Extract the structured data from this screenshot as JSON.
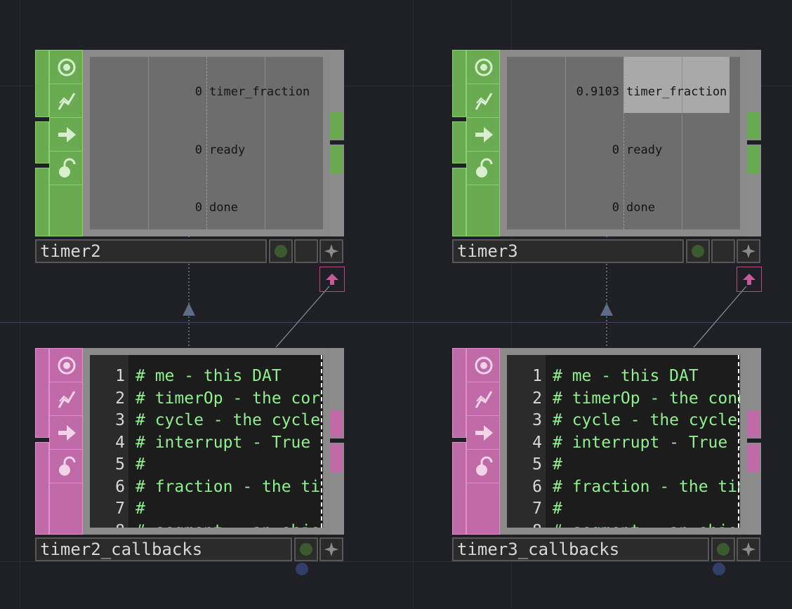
{
  "theme": {
    "chop_accent": "#6aab52",
    "chop_border": "#86d46b",
    "dat_accent": "#c06aa8",
    "dat_border": "#e28ed0"
  },
  "timer2": {
    "name": "timer2",
    "channels": [
      {
        "value": "0",
        "name": "timer_fraction"
      },
      {
        "value": "0",
        "name": "ready"
      },
      {
        "value": "0",
        "name": "done"
      }
    ],
    "fraction": 0
  },
  "timer3": {
    "name": "timer3",
    "channels": [
      {
        "value": "0.9103",
        "name": "timer_fraction"
      },
      {
        "value": "0",
        "name": "ready"
      },
      {
        "value": "0",
        "name": "done"
      }
    ],
    "fraction": 0.9103
  },
  "timer2_callbacks": {
    "name": "timer2_callbacks",
    "lines": [
      {
        "n": "1",
        "text": "# me - this DAT"
      },
      {
        "n": "2",
        "text": "# timerOp - the cor"
      },
      {
        "n": "3",
        "text": "# cycle - the cycle"
      },
      {
        "n": "4",
        "text": "# interrupt - True"
      },
      {
        "n": "5",
        "text": "#"
      },
      {
        "n": "6",
        "text": "# fraction - the ti"
      },
      {
        "n": "7",
        "text": "#"
      },
      {
        "n": "8",
        "text": "# segment - an obje"
      }
    ]
  },
  "timer3_callbacks": {
    "name": "timer3_callbacks",
    "lines": [
      {
        "n": "1",
        "text": "# me - this DAT"
      },
      {
        "n": "2",
        "text": "# timerOp - the conn"
      },
      {
        "n": "3",
        "text": "# cycle - the cycle"
      },
      {
        "n": "4",
        "text": "# interrupt - True i"
      },
      {
        "n": "5",
        "text": "#"
      },
      {
        "n": "6",
        "text": "# fraction - the tim"
      },
      {
        "n": "7",
        "text": "#"
      },
      {
        "n": "8",
        "text": "# segment - an objec"
      }
    ]
  },
  "icons": {
    "node_flags": [
      "viewer-active-icon",
      "bypass-icon",
      "export-icon",
      "lock-icon"
    ],
    "name_buttons": [
      "display-flag-icon",
      "render-flag-icon",
      "pin-icon"
    ],
    "callback_dat_link": "upload-arrow-icon"
  }
}
